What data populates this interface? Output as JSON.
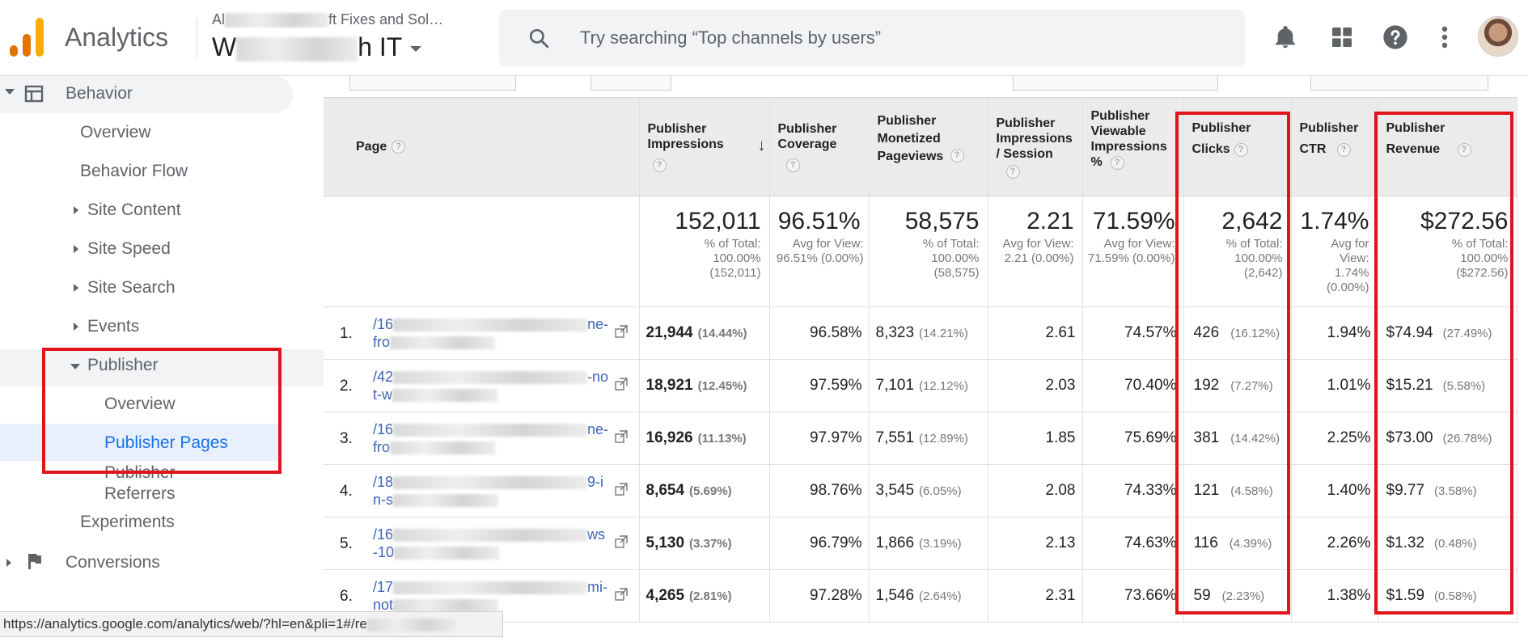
{
  "header": {
    "app_name": "Analytics",
    "account_prefix": "Al",
    "account_suffix": "ft Fixes and Sol…",
    "property_prefix": "W",
    "property_suffix": "h IT",
    "search_placeholder": "Try searching “Top channels by users”",
    "icons": [
      "notifications-icon",
      "apps-grid-icon",
      "help-icon",
      "more-vert-icon"
    ],
    "logo_colors": [
      "#f9ab00",
      "#e37400",
      "#e37400"
    ]
  },
  "sidebar": {
    "behavior": "Behavior",
    "overview": "Overview",
    "behavior_flow": "Behavior Flow",
    "site_content": "Site Content",
    "site_speed": "Site Speed",
    "site_search": "Site Search",
    "events": "Events",
    "publisher": "Publisher",
    "publisher_overview": "Overview",
    "publisher_pages": "Publisher Pages",
    "publisher_referrers": "Publisher Referrers",
    "experiments": "Experiments",
    "conversions": "Conversions"
  },
  "table": {
    "columns": [
      {
        "label": "Page"
      },
      {
        "label": "Publisher Impressions"
      },
      {
        "label": "Publisher Coverage"
      },
      {
        "label": "Publisher Monetized Pageviews"
      },
      {
        "label": "Publisher Impressions / Session"
      },
      {
        "label": "Publisher Viewable Impressions %"
      },
      {
        "label": "Publisher Clicks"
      },
      {
        "label": "Publisher CTR"
      },
      {
        "label": "Publisher Revenue"
      }
    ],
    "totals": [
      {
        "big": "152,011",
        "sub": "% of Total: 100.00% (152,011)"
      },
      {
        "big": "96.51%",
        "sub": "Avg for View: 96.51% (0.00%)"
      },
      {
        "big": "58,575",
        "sub": "% of Total: 100.00% (58,575)"
      },
      {
        "big": "2.21",
        "sub": "Avg for View: 2.21 (0.00%)"
      },
      {
        "big": "71.59%",
        "sub": "Avg for View: 71.59% (0.00%)"
      },
      {
        "big": "2,642",
        "sub": "% of Total: 100.00% (2,642)"
      },
      {
        "big": "1.74%",
        "sub": "Avg for View: 1.74% (0.00%)"
      },
      {
        "big": "$272.56",
        "sub": "% of Total: 100.00% ($272.56)"
      }
    ],
    "rows": [
      {
        "n": "1.",
        "p1": "/16",
        "p1e": "ne-",
        "p2": "fro",
        "imp": "21,944",
        "imp_pct": "(14.44%)",
        "cov": "96.58%",
        "mon": "8,323",
        "mon_pct": "(14.21%)",
        "ips": "2.61",
        "view": "74.57%",
        "clk": "426",
        "clk_pct": "(16.12%)",
        "ctr": "1.94%",
        "rev": "$74.94",
        "rev_pct": "(27.49%)"
      },
      {
        "n": "2.",
        "p1": "/42",
        "p1e": "-no",
        "p2": "t-w",
        "imp": "18,921",
        "imp_pct": "(12.45%)",
        "cov": "97.59%",
        "mon": "7,101",
        "mon_pct": "(12.12%)",
        "ips": "2.03",
        "view": "70.40%",
        "clk": "192",
        "clk_pct": "(7.27%)",
        "ctr": "1.01%",
        "rev": "$15.21",
        "rev_pct": "(5.58%)"
      },
      {
        "n": "3.",
        "p1": "/16",
        "p1e": "ne-",
        "p2": "fro",
        "imp": "16,926",
        "imp_pct": "(11.13%)",
        "cov": "97.97%",
        "mon": "7,551",
        "mon_pct": "(12.89%)",
        "ips": "1.85",
        "view": "75.69%",
        "clk": "381",
        "clk_pct": "(14.42%)",
        "ctr": "2.25%",
        "rev": "$73.00",
        "rev_pct": "(26.78%)"
      },
      {
        "n": "4.",
        "p1": "/18",
        "p1e": "9-i",
        "p2": "n-s",
        "imp": "8,654",
        "imp_pct": "(5.69%)",
        "cov": "98.76%",
        "mon": "3,545",
        "mon_pct": "(6.05%)",
        "ips": "2.08",
        "view": "74.33%",
        "clk": "121",
        "clk_pct": "(4.58%)",
        "ctr": "1.40%",
        "rev": "$9.77",
        "rev_pct": "(3.58%)"
      },
      {
        "n": "5.",
        "p1": "/16",
        "p1e": "ws",
        "p2": "-10",
        "imp": "5,130",
        "imp_pct": "(3.37%)",
        "cov": "96.79%",
        "mon": "1,866",
        "mon_pct": "(3.19%)",
        "ips": "2.13",
        "view": "74.63%",
        "clk": "116",
        "clk_pct": "(4.39%)",
        "ctr": "2.26%",
        "rev": "$1.32",
        "rev_pct": "(0.48%)"
      },
      {
        "n": "6.",
        "p1": "/17",
        "p1e": "mi-",
        "p2": "not",
        "imp": "4,265",
        "imp_pct": "(2.81%)",
        "cov": "97.28%",
        "mon": "1,546",
        "mon_pct": "(2.64%)",
        "ips": "2.31",
        "view": "73.66%",
        "clk": "59",
        "clk_pct": "(2.23%)",
        "ctr": "1.38%",
        "rev": "$1.59",
        "rev_pct": "(0.58%)"
      }
    ]
  },
  "statusbar": {
    "url": "https://analytics.google.com/analytics/web/?hl=en&pli=1#/re"
  },
  "colors": {
    "highlight": "#e0151b",
    "link": "#3a63b8",
    "selected_bg": "#e8f0fe"
  }
}
